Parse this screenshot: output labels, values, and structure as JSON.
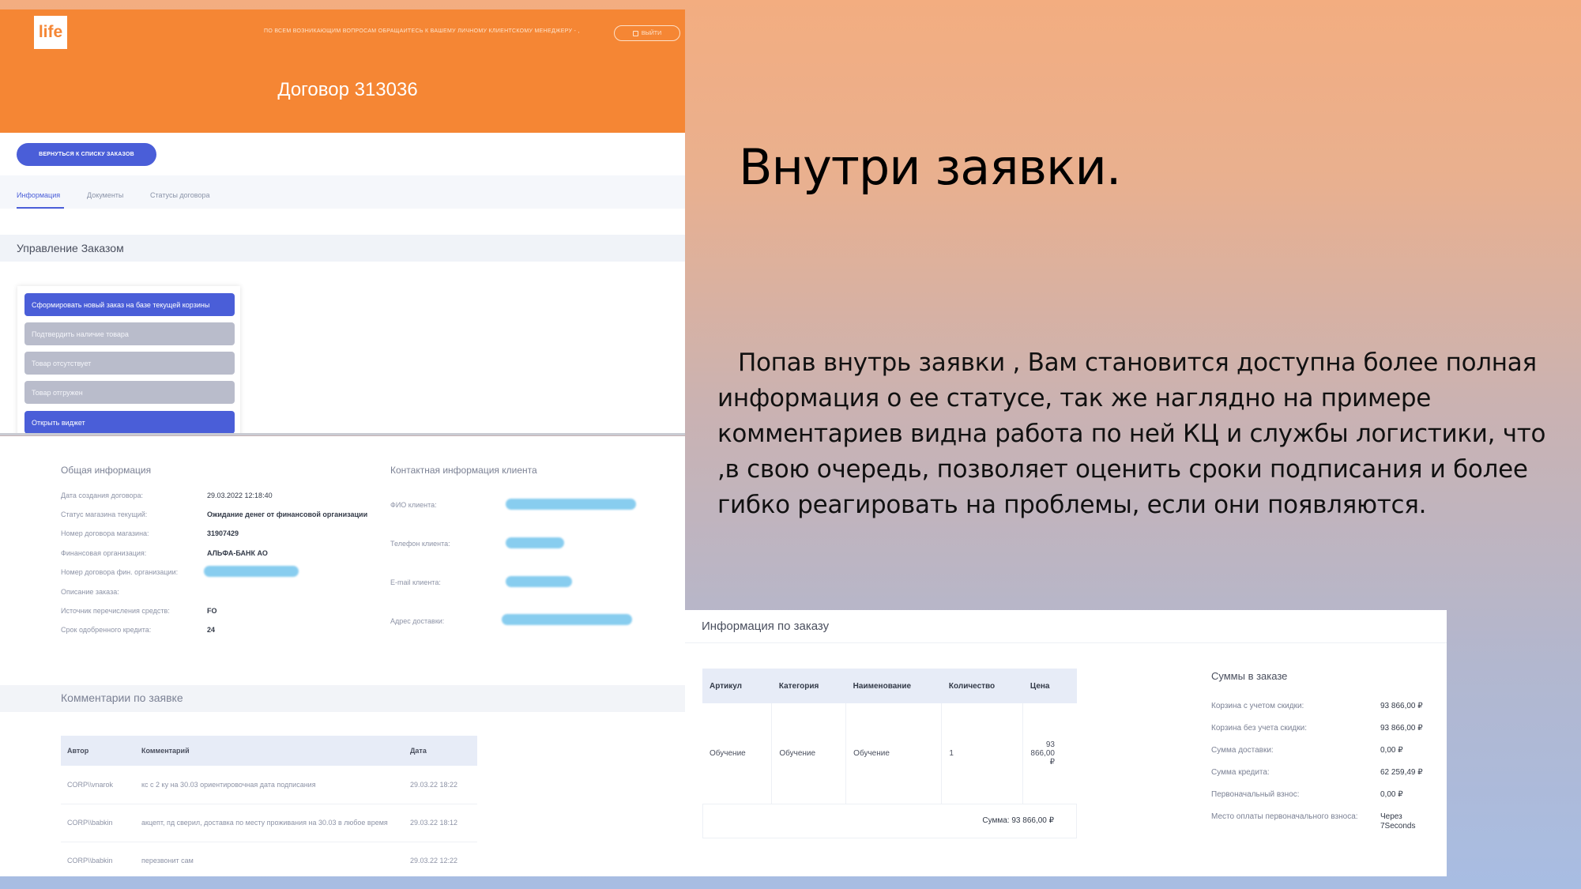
{
  "shot1": {
    "logo": "life",
    "manager_notice": "ПО ВСЕМ ВОЗНИКАЮЩИМ ВОПРОСАМ ОБРАЩАЙТЕСЬ К ВАШЕМУ ЛИЧНОМУ КЛИЕНТСКОМУ МЕНЕДЖЕРУ - ,",
    "exit_label": "ВЫЙТИ",
    "contract_title": "Договор 313036",
    "back_button": "ВЕРНУТЬСЯ К СПИСКУ ЗАКАЗОВ",
    "tabs": [
      "Информация",
      "Документы",
      "Статусы договора"
    ],
    "management_title": "Управление Заказом",
    "actions": [
      "Сформировать новый заказ на базе текущей корзины",
      "Подтвердить наличие товара",
      "Товар отсутствует",
      "Товар отгружен",
      "Открыть виджет"
    ]
  },
  "shot2": {
    "general_title": "Общая информация",
    "general": [
      {
        "label": "Дата создания договора:",
        "value": "29.03.2022 12:18:40"
      },
      {
        "label": "Статус магазина текущий:",
        "value": "Ожидание денег от финансовой организации"
      },
      {
        "label": "Номер договора магазина:",
        "value": "31907429"
      },
      {
        "label": "Финансовая организация:",
        "value": "АЛЬФА-БАНК АО"
      },
      {
        "label": "Номер договора фин. организации:",
        "value": ""
      },
      {
        "label": "Описание заказа:",
        "value": ""
      },
      {
        "label": "Источник перечисления средств:",
        "value": "FO"
      },
      {
        "label": "Срок одобренного кредита:",
        "value": "24"
      }
    ],
    "contact_title": "Контактная информация клиента",
    "contact_labels": [
      "ФИО клиента:",
      "Телефон клиента:",
      "E-mail клиента:",
      "Адрес доставки:"
    ],
    "comments_title": "Комментарии по заявке",
    "comments_headers": [
      "Автор",
      "Комментарий",
      "Дата"
    ],
    "comments": [
      {
        "author": "CORP\\\\vnarok",
        "text": "кс с 2 ку на 30.03 ориентировочная дата подписания",
        "date": "29.03.22 18:22"
      },
      {
        "author": "CORP\\\\babkin",
        "text": "акцепт, пд сверил, доставка по месту проживания на 30.03 в любое время",
        "date": "29.03.22 18:12"
      },
      {
        "author": "CORP\\\\babkin",
        "text": "перезвонит сам",
        "date": "29.03.22 12:22"
      }
    ]
  },
  "slide": {
    "heading": "Внутри заявки.",
    "body": "Попав внутрь заявки , Вам становится доступна более полная информация о ее статусе, так же наглядно на примере комментариев видна работа по ней КЦ и службы логистики, что ,в свою очередь, позволяет оценить сроки подписания и более гибко реагировать на проблемы, если они появляются."
  },
  "order_info": {
    "title": "Информация по заказу",
    "headers": [
      "Артикул",
      "Категория",
      "Наименование",
      "Количество",
      "Цена"
    ],
    "row": [
      "Обучение",
      "Обучение",
      "Обучение",
      "1",
      "93 866,00 ₽"
    ],
    "sum_label": "Сумма: 93 866,00 ₽",
    "sums_title": "Суммы в заказе",
    "sums": [
      {
        "label": "Корзина с учетом скидки:",
        "value": "93 866,00 ₽"
      },
      {
        "label": "Корзина без учета скидки:",
        "value": "93 866,00 ₽"
      },
      {
        "label": "Сумма доставки:",
        "value": "0,00 ₽"
      },
      {
        "label": "Сумма кредита:",
        "value": "62 259,49 ₽"
      },
      {
        "label": "Первоначальный взнос:",
        "value": "0,00 ₽"
      },
      {
        "label": "Место оплаты первоначального взноса:",
        "value": "Через 7Seconds"
      }
    ]
  }
}
